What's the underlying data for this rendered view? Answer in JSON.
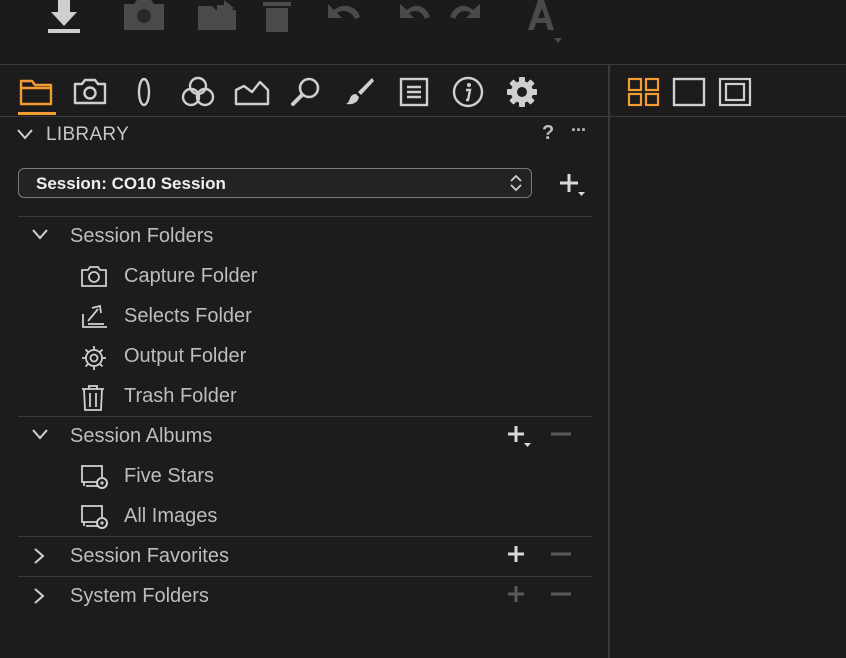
{
  "colors": {
    "accent": "#f39c32",
    "background": "#1c1c1c",
    "text": "#bdbdbd",
    "icon_dim": "#4a4a4a",
    "icon": "#cfcfcf"
  },
  "toolbar": {
    "icons": [
      "import-icon",
      "camera-icon",
      "folder-export-icon",
      "trash-icon",
      "undo-all-icon",
      "undo-icon",
      "redo-icon",
      "text-style-icon"
    ]
  },
  "tool_tabs": {
    "icons": [
      "library-folder-icon",
      "capture-camera-icon",
      "lens-icon",
      "color-circles-icon",
      "exposure-histogram-icon",
      "details-magnifier-icon",
      "adjustments-brush-icon",
      "metadata-list-icon",
      "info-icon",
      "settings-gear-icon"
    ],
    "active_index": 0
  },
  "viewer_modes": [
    "grid-view-icon",
    "single-view-icon",
    "fullscreen-view-icon"
  ],
  "library": {
    "title": "LIBRARY",
    "help_label": "?",
    "more_label": "···",
    "session_select": {
      "value": "Session: CO10 Session"
    },
    "sections": [
      {
        "label": "Session Folders",
        "expanded": true,
        "items": [
          {
            "label": "Capture Folder",
            "icon": "capture-folder-icon"
          },
          {
            "label": "Selects Folder",
            "icon": "selects-folder-icon"
          },
          {
            "label": "Output Folder",
            "icon": "output-folder-icon"
          },
          {
            "label": "Trash Folder",
            "icon": "trash-folder-icon"
          }
        ]
      },
      {
        "label": "Session Albums",
        "expanded": true,
        "items": [
          {
            "label": "Five Stars",
            "icon": "smart-album-icon"
          },
          {
            "label": "All Images",
            "icon": "smart-album-icon"
          }
        ]
      },
      {
        "label": "Session Favorites",
        "expanded": false,
        "items": []
      },
      {
        "label": "System Folders",
        "expanded": false,
        "items": []
      }
    ]
  }
}
